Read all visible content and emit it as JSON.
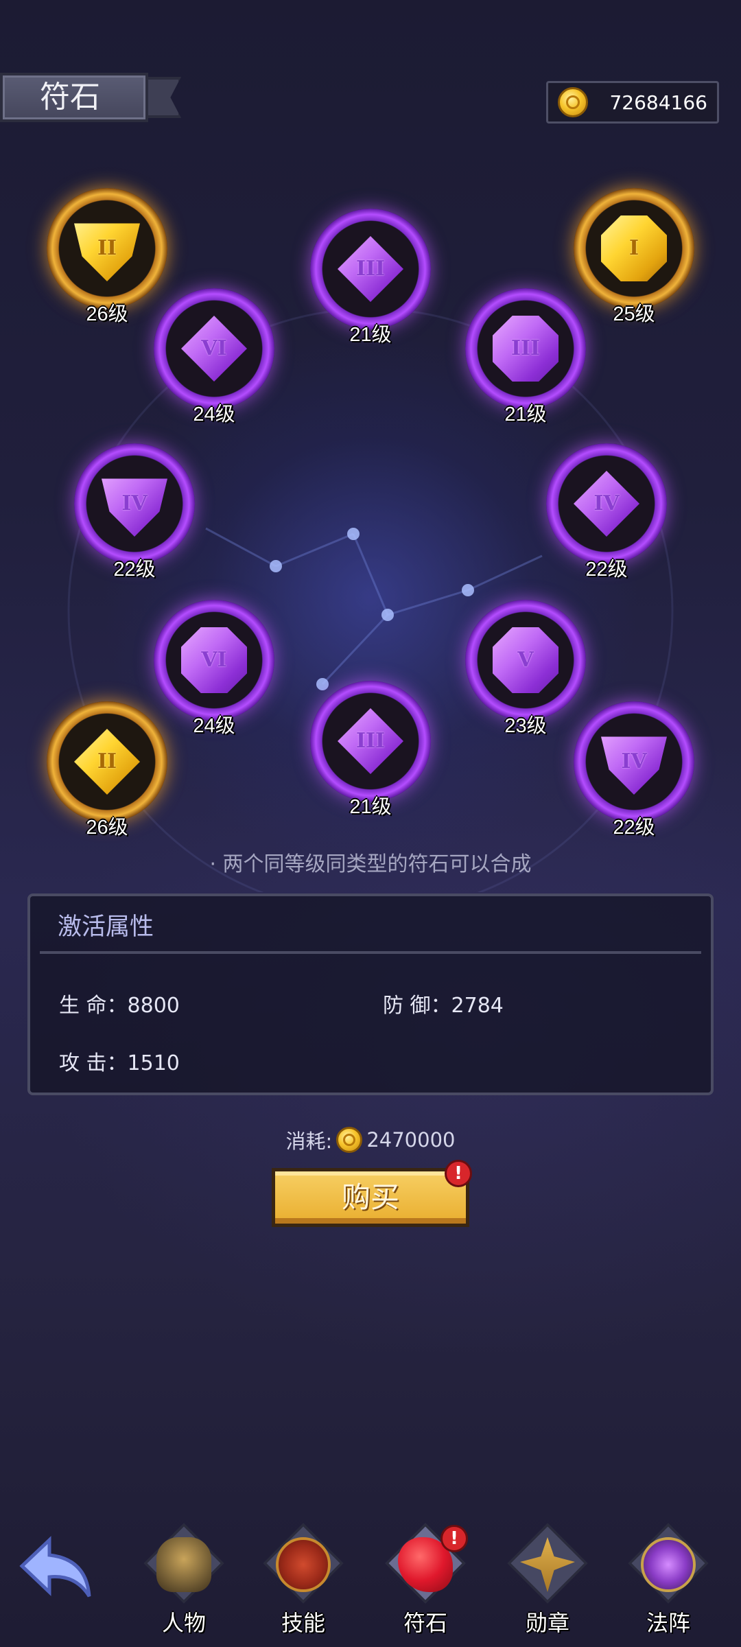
{
  "header": {
    "title": "符石",
    "coins": "72684166"
  },
  "runes": [
    {
      "id": "r1",
      "numeral": "II",
      "level": "26级",
      "color": "gold",
      "shape": "shield"
    },
    {
      "id": "r2",
      "numeral": "III",
      "level": "21级",
      "color": "purple",
      "shape": "diamond"
    },
    {
      "id": "r3",
      "numeral": "I",
      "level": "25级",
      "color": "gold",
      "shape": "octagon"
    },
    {
      "id": "r4",
      "numeral": "VI",
      "level": "24级",
      "color": "purple",
      "shape": "diamond"
    },
    {
      "id": "r5",
      "numeral": "III",
      "level": "21级",
      "color": "purple",
      "shape": "octagon"
    },
    {
      "id": "r6",
      "numeral": "IV",
      "level": "22级",
      "color": "purple",
      "shape": "shield"
    },
    {
      "id": "r7",
      "numeral": "IV",
      "level": "22级",
      "color": "purple",
      "shape": "diamond"
    },
    {
      "id": "r8",
      "numeral": "VI",
      "level": "24级",
      "color": "purple",
      "shape": "octagon"
    },
    {
      "id": "r9",
      "numeral": "V",
      "level": "23级",
      "color": "purple",
      "shape": "octagon"
    },
    {
      "id": "r10",
      "numeral": "II",
      "level": "26级",
      "color": "gold",
      "shape": "diamond"
    },
    {
      "id": "r11",
      "numeral": "III",
      "level": "21级",
      "color": "purple",
      "shape": "diamond"
    },
    {
      "id": "r12",
      "numeral": "IV",
      "level": "22级",
      "color": "purple",
      "shape": "shield"
    }
  ],
  "hint": "· 两个同等级同类型的符石可以合成",
  "panel": {
    "title": "激活属性",
    "stats": {
      "hp_label": "生 命：",
      "hp_value": "8800",
      "def_label": "防 御：",
      "def_value": "2784",
      "atk_label": "攻 击：",
      "atk_value": "1510"
    }
  },
  "purchase": {
    "cost_label": "消耗:",
    "cost_value": "2470000",
    "buy_label": "购买",
    "alert": "!"
  },
  "nav": {
    "items": [
      {
        "label": "人物",
        "icon": "helmet-icon"
      },
      {
        "label": "技能",
        "icon": "skill-swirl-icon"
      },
      {
        "label": "符石",
        "icon": "rune-stone-icon",
        "alert": "!"
      },
      {
        "label": "勋章",
        "icon": "medal-sword-icon"
      },
      {
        "label": "法阵",
        "icon": "magic-circle-icon"
      }
    ]
  },
  "colors": {
    "accent_gold": "#f0b33a",
    "rune_purple": "#b44dff",
    "alert_red": "#d8262b"
  }
}
